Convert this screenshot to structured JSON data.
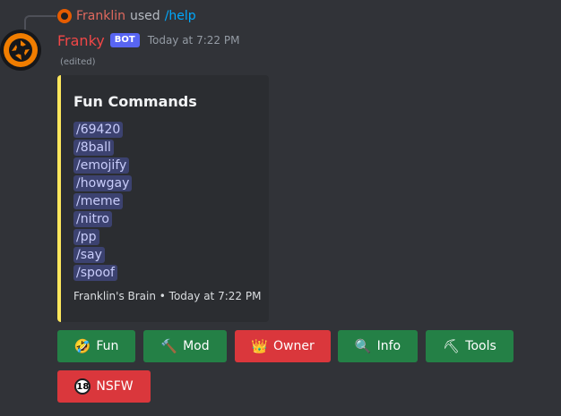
{
  "reply": {
    "user": "Franklin",
    "action": "used",
    "command": "/help"
  },
  "message": {
    "author": "Franky",
    "bot_tag": "BOT",
    "timestamp": "Today at 7:22 PM",
    "edited": "(edited)"
  },
  "embed": {
    "accent_color": "#fee75c",
    "title": "Fun Commands",
    "commands": [
      "/69420",
      "/8ball",
      "/emojify",
      "/howgay",
      "/meme",
      "/nitro",
      "/pp",
      "/say",
      "/spoof"
    ],
    "footer": "Franklin's Brain • Today at 7:22 PM"
  },
  "buttons": [
    {
      "label": "Fun",
      "emoji": "🤣",
      "icon": "rofl-emoji-icon",
      "color": "#248046"
    },
    {
      "label": "Mod",
      "emoji": "🔨",
      "icon": "hammer-emoji-icon",
      "color": "#248046"
    },
    {
      "label": "Owner",
      "emoji": "👑",
      "icon": "crown-emoji-icon",
      "color": "#da373c"
    },
    {
      "label": "Info",
      "emoji": "🔍",
      "icon": "magnifier-emoji-icon",
      "color": "#248046"
    },
    {
      "label": "Tools",
      "emoji": "⛏",
      "icon": "pick-emoji-icon",
      "color": "#248046"
    },
    {
      "label": "NSFW",
      "emoji": "18",
      "icon": "no-under-18-emoji-icon",
      "color": "#da373c"
    }
  ]
}
